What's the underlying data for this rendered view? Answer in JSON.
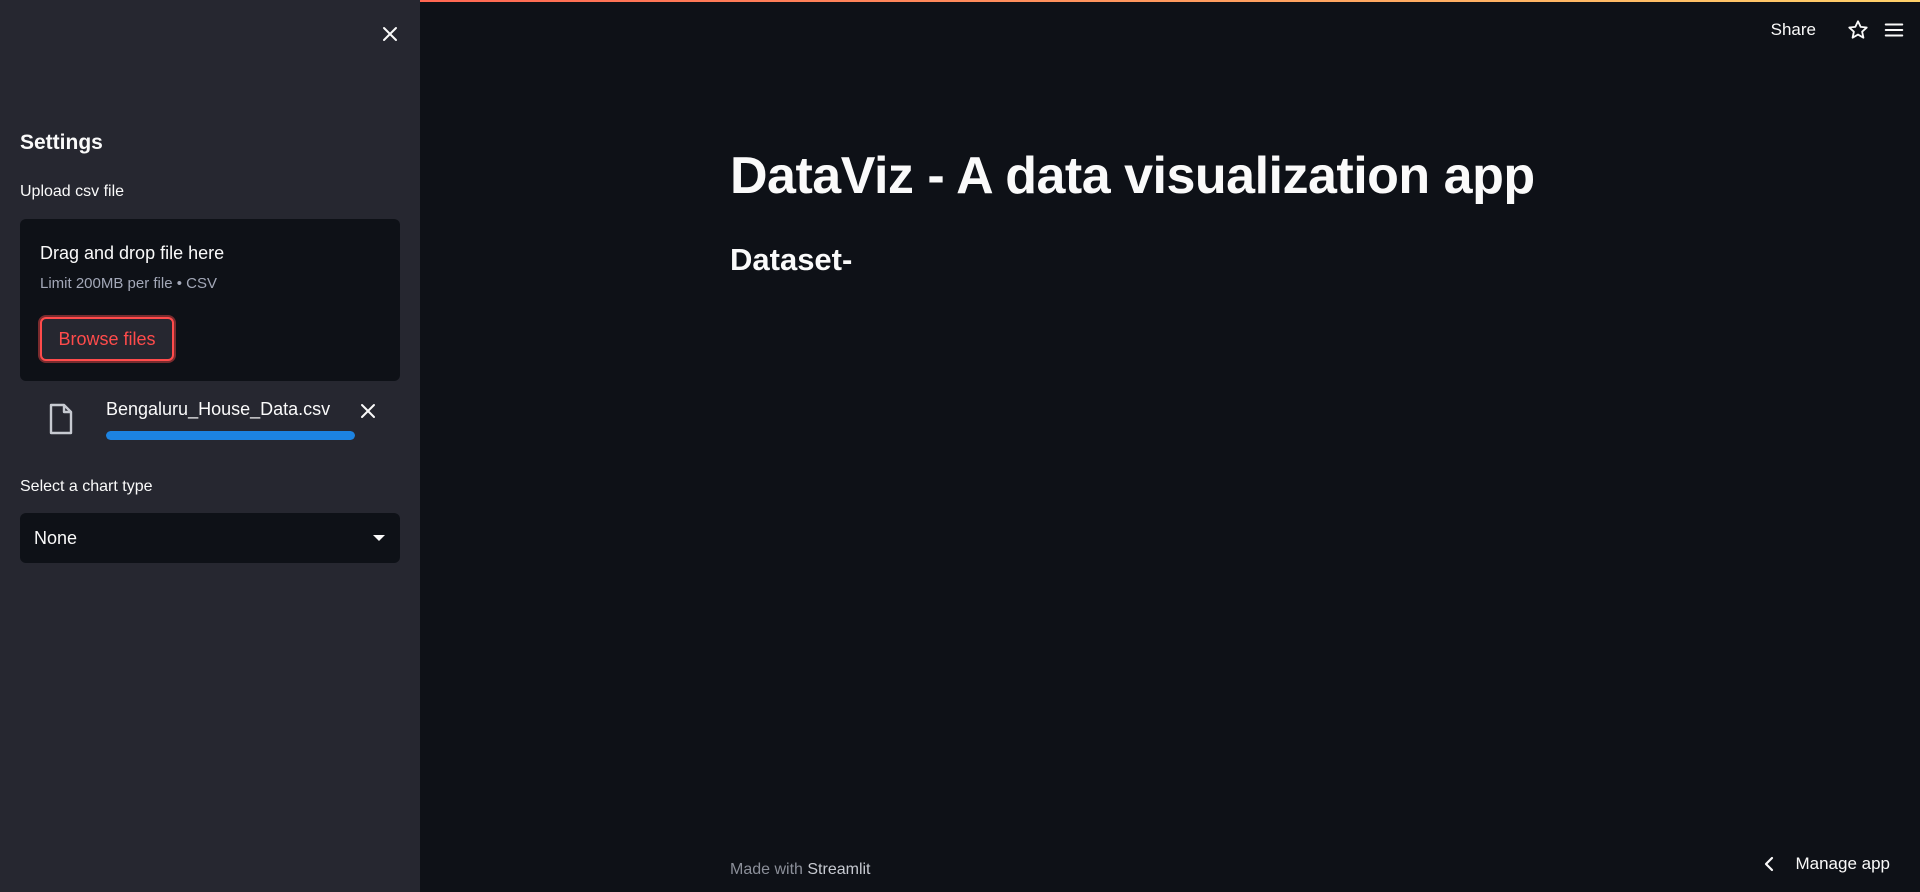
{
  "header": {
    "share_label": "Share",
    "icons": [
      "star-icon",
      "hamburger-menu-icon"
    ]
  },
  "sidebar": {
    "heading": "Settings",
    "upload_label": "Upload csv file",
    "uploader": {
      "drag_text": "Drag and drop file here",
      "limit_text": "Limit 200MB per file • CSV",
      "browse_label": "Browse files"
    },
    "uploaded_file": {
      "name": "Bengaluru_House_Data.csv",
      "progress": 1.0
    },
    "chart_type_label": "Select a chart type",
    "chart_type_value": "None"
  },
  "main": {
    "title": "DataViz - A data visualization app",
    "section_heading": "Dataset-"
  },
  "footer": {
    "made_with": "Made with",
    "brand": "Streamlit"
  },
  "manage_app_label": "Manage app",
  "colors": {
    "background": "#0e1117",
    "sidebar": "#262730",
    "accent": "#ff4b4b",
    "progress": "#1c83e1"
  }
}
